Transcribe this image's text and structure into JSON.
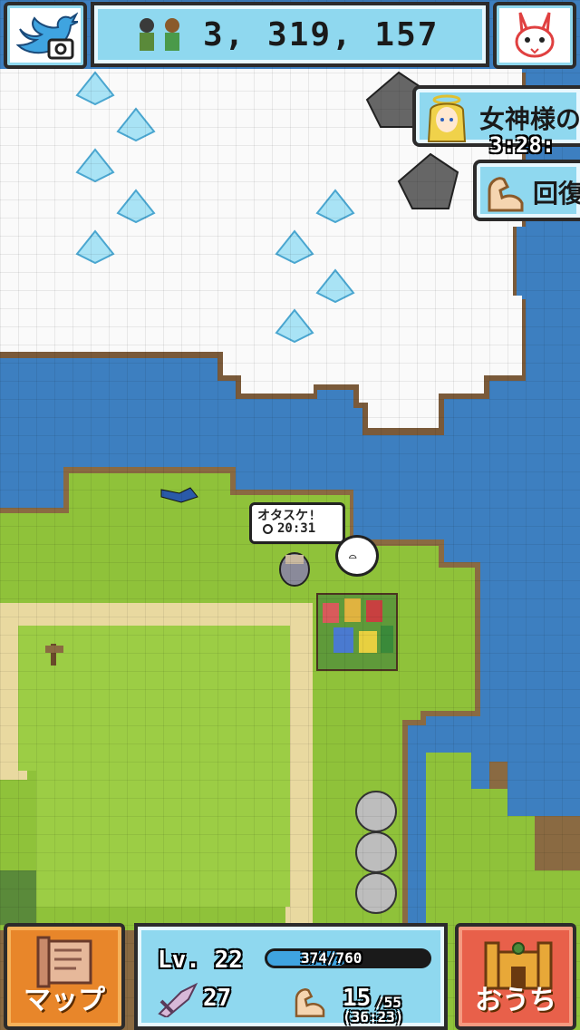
{
  "header": {
    "gold_value": "3, 319, 157"
  },
  "banners": {
    "goddess_label": "女神様の",
    "goddess_timer": "3:28:",
    "recover_label": "回復"
  },
  "map": {
    "npc_bubble_title": "オタスケ!",
    "npc_bubble_timer": "20:31"
  },
  "status": {
    "level_label": "Lv. 22",
    "exp_text": "374/760",
    "exp_fraction": 0.49,
    "attack_value": "27",
    "stamina_current": "15",
    "stamina_max": "/55",
    "stamina_timer": "(36:23)"
  },
  "buttons": {
    "map_label": "マップ",
    "home_label": "おうち"
  }
}
